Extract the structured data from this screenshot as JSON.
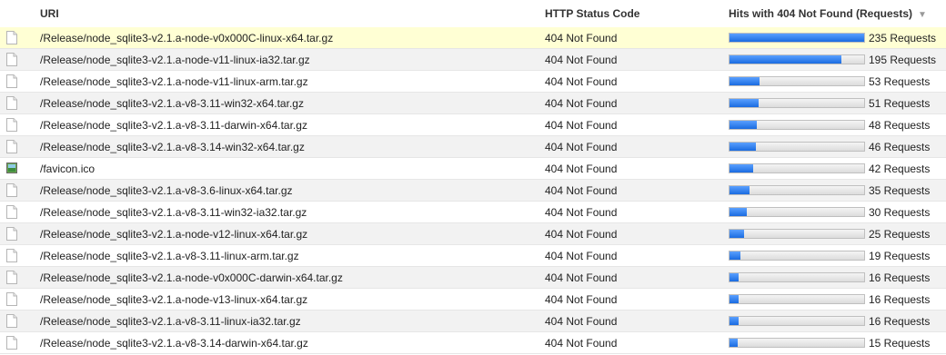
{
  "table": {
    "columns": {
      "uri": "URI",
      "status": "HTTP Status Code",
      "hits": "Hits with 404 Not Found (Requests)",
      "sort_indicator": "▼"
    },
    "max_hits": 235,
    "rows": [
      {
        "icon": "file-icon",
        "uri": "/Release/node_sqlite3-v2.1.a-node-v0x000C-linux-x64.tar.gz",
        "status": "404 Not Found",
        "hits": 235,
        "hits_label": "235 Requests"
      },
      {
        "icon": "file-icon",
        "uri": "/Release/node_sqlite3-v2.1.a-node-v11-linux-ia32.tar.gz",
        "status": "404 Not Found",
        "hits": 195,
        "hits_label": "195 Requests"
      },
      {
        "icon": "file-icon",
        "uri": "/Release/node_sqlite3-v2.1.a-node-v11-linux-arm.tar.gz",
        "status": "404 Not Found",
        "hits": 53,
        "hits_label": "53 Requests"
      },
      {
        "icon": "file-icon",
        "uri": "/Release/node_sqlite3-v2.1.a-v8-3.11-win32-x64.tar.gz",
        "status": "404 Not Found",
        "hits": 51,
        "hits_label": "51 Requests"
      },
      {
        "icon": "file-icon",
        "uri": "/Release/node_sqlite3-v2.1.a-v8-3.11-darwin-x64.tar.gz",
        "status": "404 Not Found",
        "hits": 48,
        "hits_label": "48 Requests"
      },
      {
        "icon": "file-icon",
        "uri": "/Release/node_sqlite3-v2.1.a-v8-3.14-win32-x64.tar.gz",
        "status": "404 Not Found",
        "hits": 46,
        "hits_label": "46 Requests"
      },
      {
        "icon": "image-icon",
        "uri": "/favicon.ico",
        "status": "404 Not Found",
        "hits": 42,
        "hits_label": "42 Requests"
      },
      {
        "icon": "file-icon",
        "uri": "/Release/node_sqlite3-v2.1.a-v8-3.6-linux-x64.tar.gz",
        "status": "404 Not Found",
        "hits": 35,
        "hits_label": "35 Requests"
      },
      {
        "icon": "file-icon",
        "uri": "/Release/node_sqlite3-v2.1.a-v8-3.11-win32-ia32.tar.gz",
        "status": "404 Not Found",
        "hits": 30,
        "hits_label": "30 Requests"
      },
      {
        "icon": "file-icon",
        "uri": "/Release/node_sqlite3-v2.1.a-node-v12-linux-x64.tar.gz",
        "status": "404 Not Found",
        "hits": 25,
        "hits_label": "25 Requests"
      },
      {
        "icon": "file-icon",
        "uri": "/Release/node_sqlite3-v2.1.a-v8-3.11-linux-arm.tar.gz",
        "status": "404 Not Found",
        "hits": 19,
        "hits_label": "19 Requests"
      },
      {
        "icon": "file-icon",
        "uri": "/Release/node_sqlite3-v2.1.a-node-v0x000C-darwin-x64.tar.gz",
        "status": "404 Not Found",
        "hits": 16,
        "hits_label": "16 Requests"
      },
      {
        "icon": "file-icon",
        "uri": "/Release/node_sqlite3-v2.1.a-node-v13-linux-x64.tar.gz",
        "status": "404 Not Found",
        "hits": 16,
        "hits_label": "16 Requests"
      },
      {
        "icon": "file-icon",
        "uri": "/Release/node_sqlite3-v2.1.a-v8-3.11-linux-ia32.tar.gz",
        "status": "404 Not Found",
        "hits": 16,
        "hits_label": "16 Requests"
      },
      {
        "icon": "file-icon",
        "uri": "/Release/node_sqlite3-v2.1.a-v8-3.14-darwin-x64.tar.gz",
        "status": "404 Not Found",
        "hits": 15,
        "hits_label": "15 Requests"
      }
    ]
  },
  "colors": {
    "highlight_row": "#ffffd4",
    "alt_row": "#f2f2f2",
    "bar_fill": "#1a6be0"
  }
}
